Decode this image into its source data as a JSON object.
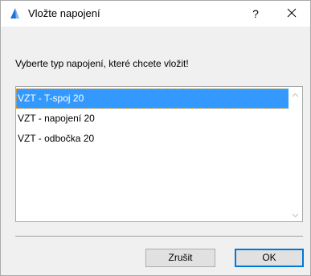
{
  "window": {
    "title": "Vložte napojení",
    "help_label": "?",
    "close_icon": "close-icon",
    "app_icon": "archicad-icon"
  },
  "prompt": "Vyberte typ napojení, které chcete vložit!",
  "list": {
    "items": [
      {
        "label": "VZT - T-spoj 20",
        "selected": true
      },
      {
        "label": "VZT - napojení 20",
        "selected": false
      },
      {
        "label": "VZT - odbočka 20",
        "selected": false
      }
    ]
  },
  "buttons": {
    "cancel_label": "Zrušit",
    "ok_label": "OK"
  },
  "colors": {
    "selection": "#3399ff",
    "default_button_border": "#0078d7",
    "dialog_background": "#f0f0f0"
  }
}
